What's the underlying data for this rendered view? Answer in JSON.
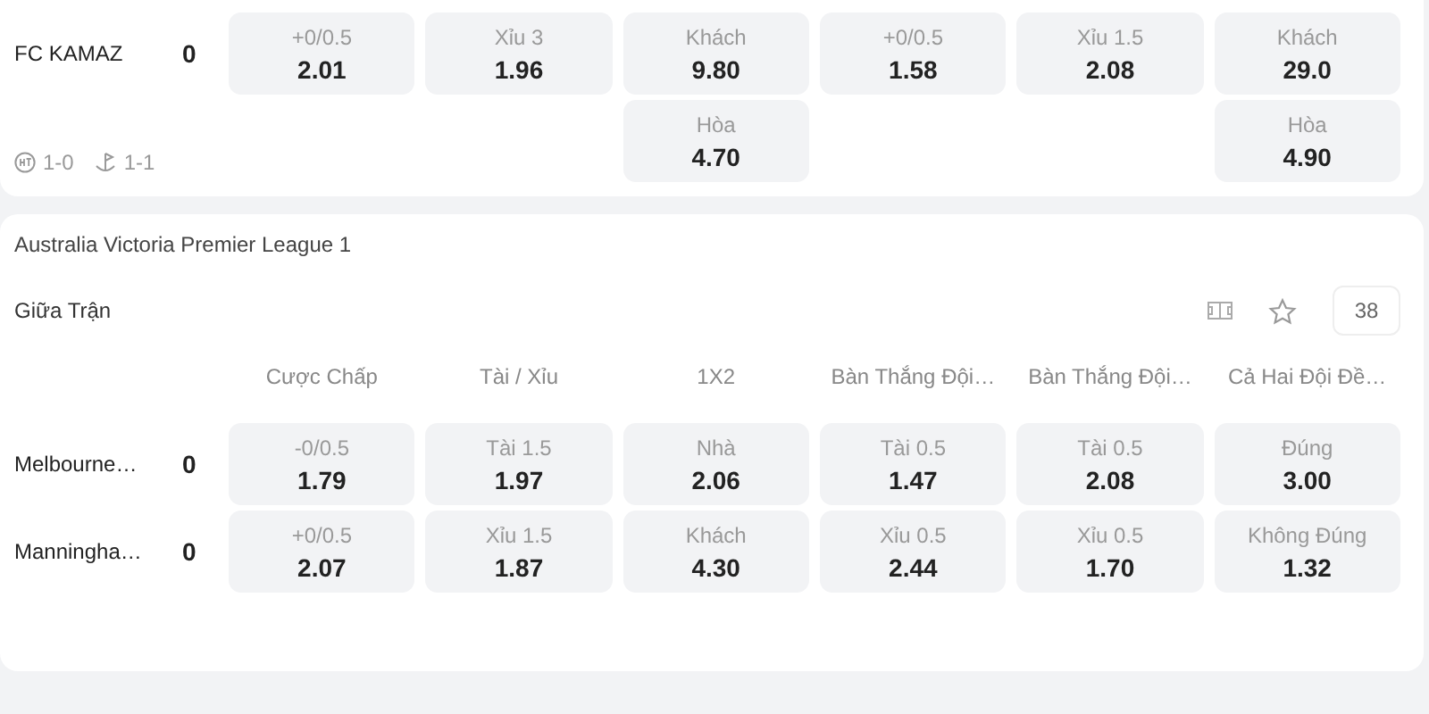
{
  "cards": [
    {
      "rows": [
        {
          "team": "FC KAMAZ",
          "score": "0",
          "cells": [
            {
              "kind": "odds",
              "line": "+0/0.5",
              "price": "2.01"
            },
            {
              "kind": "odds",
              "line": "Xỉu 3",
              "price": "1.96"
            },
            {
              "kind": "odds",
              "line": "Khách",
              "price": "9.80"
            },
            {
              "kind": "odds",
              "line": "+0/0.5",
              "price": "1.58"
            },
            {
              "kind": "odds",
              "line": "Xỉu 1.5",
              "price": "2.08"
            },
            {
              "kind": "odds",
              "line": "Khách",
              "price": "29.0"
            }
          ]
        },
        {
          "stats": [
            {
              "kind": "ht",
              "value": "1-0"
            },
            {
              "kind": "corner",
              "value": "1-1"
            }
          ],
          "cells": [
            {
              "kind": "empty"
            },
            {
              "kind": "empty"
            },
            {
              "kind": "odds",
              "line": "Hòa",
              "price": "4.70"
            },
            {
              "kind": "empty"
            },
            {
              "kind": "empty"
            },
            {
              "kind": "odds",
              "line": "Hòa",
              "price": "4.90"
            }
          ]
        }
      ]
    },
    {
      "league": "Australia Victoria Premier League 1",
      "section": "Giữa Trận",
      "count": "38",
      "columns": [
        "Cược Chấp",
        "Tài / Xỉu",
        "1X2",
        "Bàn Thắng Đội…",
        "Bàn Thắng Đội…",
        "Cả Hai Đội Đề…"
      ],
      "rows": [
        {
          "team": "Melbourne…",
          "score": "0",
          "cells": [
            {
              "kind": "odds",
              "line": "-0/0.5",
              "price": "1.79"
            },
            {
              "kind": "odds",
              "line": "Tài 1.5",
              "price": "1.97"
            },
            {
              "kind": "odds",
              "line": "Nhà",
              "price": "2.06"
            },
            {
              "kind": "odds",
              "line": "Tài 0.5",
              "price": "1.47"
            },
            {
              "kind": "odds",
              "line": "Tài 0.5",
              "price": "2.08"
            },
            {
              "kind": "odds",
              "line": "Đúng",
              "price": "3.00"
            }
          ]
        },
        {
          "team": "Manningha…",
          "score": "0",
          "cells": [
            {
              "kind": "odds",
              "line": "+0/0.5",
              "price": "2.07"
            },
            {
              "kind": "odds",
              "line": "Xỉu 1.5",
              "price": "1.87"
            },
            {
              "kind": "odds",
              "line": "Khách",
              "price": "4.30"
            },
            {
              "kind": "odds",
              "line": "Xỉu 0.5",
              "price": "2.44"
            },
            {
              "kind": "odds",
              "line": "Xỉu 0.5",
              "price": "1.70"
            },
            {
              "kind": "odds",
              "line": "Không Đúng",
              "price": "1.32"
            }
          ]
        }
      ]
    }
  ]
}
